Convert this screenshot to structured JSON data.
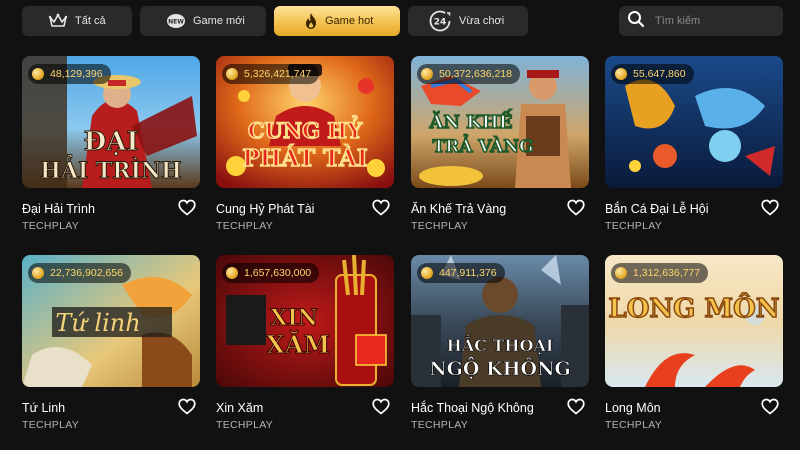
{
  "tabs": [
    {
      "label": "Tất cả",
      "icon": "crown-icon",
      "active": false
    },
    {
      "label": "Game mới",
      "icon": "new-badge-icon",
      "active": false
    },
    {
      "label": "Game hot",
      "icon": "flame-icon",
      "active": true
    },
    {
      "label": "Vừa chơi",
      "icon": "clock-24-icon",
      "active": false
    }
  ],
  "search": {
    "placeholder": "Tìm kiếm",
    "icon": "search-icon"
  },
  "accent": "#f3c24f",
  "games": [
    {
      "name": "Đại Hải Trình",
      "provider": "TECHPLAY",
      "jackpot": "48,129,396",
      "art_text": [
        "ĐẠI",
        "HẢI TRÌNH"
      ]
    },
    {
      "name": "Cung Hỷ Phát Tài",
      "provider": "TECHPLAY",
      "jackpot": "5,326,421,747",
      "art_text": [
        "CUNG HỶ",
        "PHÁT TÀI"
      ]
    },
    {
      "name": "Ăn Khế Trả Vàng",
      "provider": "TECHPLAY",
      "jackpot": "50,372,636,218",
      "art_text": [
        "ĂN KHẾ",
        "TRẢ VÀNG"
      ]
    },
    {
      "name": "Bắn Cá Đại Lễ Hội",
      "provider": "TECHPLAY",
      "jackpot": "55,647,860",
      "art_text": []
    },
    {
      "name": "Tứ Linh",
      "provider": "TECHPLAY",
      "jackpot": "22,736,902,656",
      "art_text": [
        "Tứ linh"
      ]
    },
    {
      "name": "Xin Xăm",
      "provider": "TECHPLAY",
      "jackpot": "1,657,630,000",
      "art_text": [
        "XIN",
        "XĂM"
      ]
    },
    {
      "name": "Hắc Thoại Ngộ Không",
      "provider": "TECHPLAY",
      "jackpot": "447,911,376",
      "art_text": [
        "HẮC THOẠI",
        "NGỘ KHÔNG"
      ]
    },
    {
      "name": "Long Môn",
      "provider": "TECHPLAY",
      "jackpot": "1,312,636,777",
      "art_text": [
        "LONG MÔN"
      ]
    }
  ]
}
